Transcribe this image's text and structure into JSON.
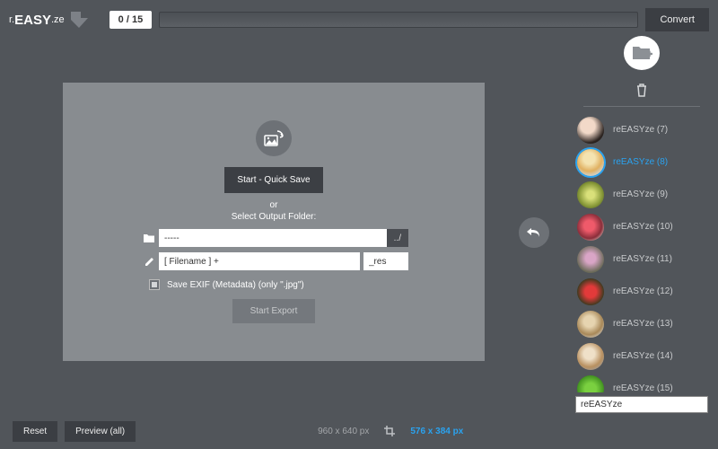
{
  "logo": {
    "r": "r.",
    "easy": "EASY",
    "ze": ".ze"
  },
  "counter": "0 / 15",
  "convert_label": "Convert",
  "dialog": {
    "quick_save": "Start - Quick Save",
    "or": "or",
    "select_output": "Select Output Folder:",
    "path_value": "-----",
    "browse_label": "../",
    "filename_value": "[ Filename ] +",
    "suffix_value": "_res",
    "exif_label": "Save EXIF (Metadata) (only \".jpg\")",
    "start_export": "Start Export"
  },
  "thumbs": [
    {
      "label": "reEASYze (7)",
      "bg": "radial-gradient(circle at 40% 35%, #f2d9c8 30%, #2b2320 70%)",
      "selected": false
    },
    {
      "label": "reEASYze (8)",
      "bg": "radial-gradient(circle at 45% 35%, #f4e3b0 25%, #e0b060 55%, #cfd6da 80%)",
      "selected": true
    },
    {
      "label": "reEASYze (9)",
      "bg": "radial-gradient(circle at 50% 50%, #d9e07a 20%, #8a9b3a 60%, #4a5a20 90%)",
      "selected": false
    },
    {
      "label": "reEASYze (10)",
      "bg": "radial-gradient(circle at 45% 45%, #ef5a6a 25%, #8a2e3a 60%, #efe8dc 90%)",
      "selected": false
    },
    {
      "label": "reEASYze (11)",
      "bg": "radial-gradient(circle at 50% 45%, #d9a5c6 25%, #6a6a58 70%)",
      "selected": false
    },
    {
      "label": "reEASYze (12)",
      "bg": "radial-gradient(circle at 50% 50%, #e23a3a 30%, #2d3a1c 75%)",
      "selected": false
    },
    {
      "label": "reEASYze (13)",
      "bg": "radial-gradient(circle at 45% 40%, #e6d4b0 25%, #a88858 60%, #d8dcdf 90%)",
      "selected": false
    },
    {
      "label": "reEASYze (14)",
      "bg": "radial-gradient(circle at 45% 40%, #efe0c8 25%, #b89060 60%, #9aa0a6 90%)",
      "selected": false
    },
    {
      "label": "reEASYze (15)",
      "bg": "radial-gradient(circle at 50% 50%, #7ad040 30%, #3a8a1c 75%)",
      "selected": false
    }
  ],
  "search_value": "reEASYze",
  "bottom": {
    "reset": "Reset",
    "preview": "Preview (all)",
    "orig_dim": "960 x 640 px",
    "target_dim": "576 x 384 px"
  }
}
